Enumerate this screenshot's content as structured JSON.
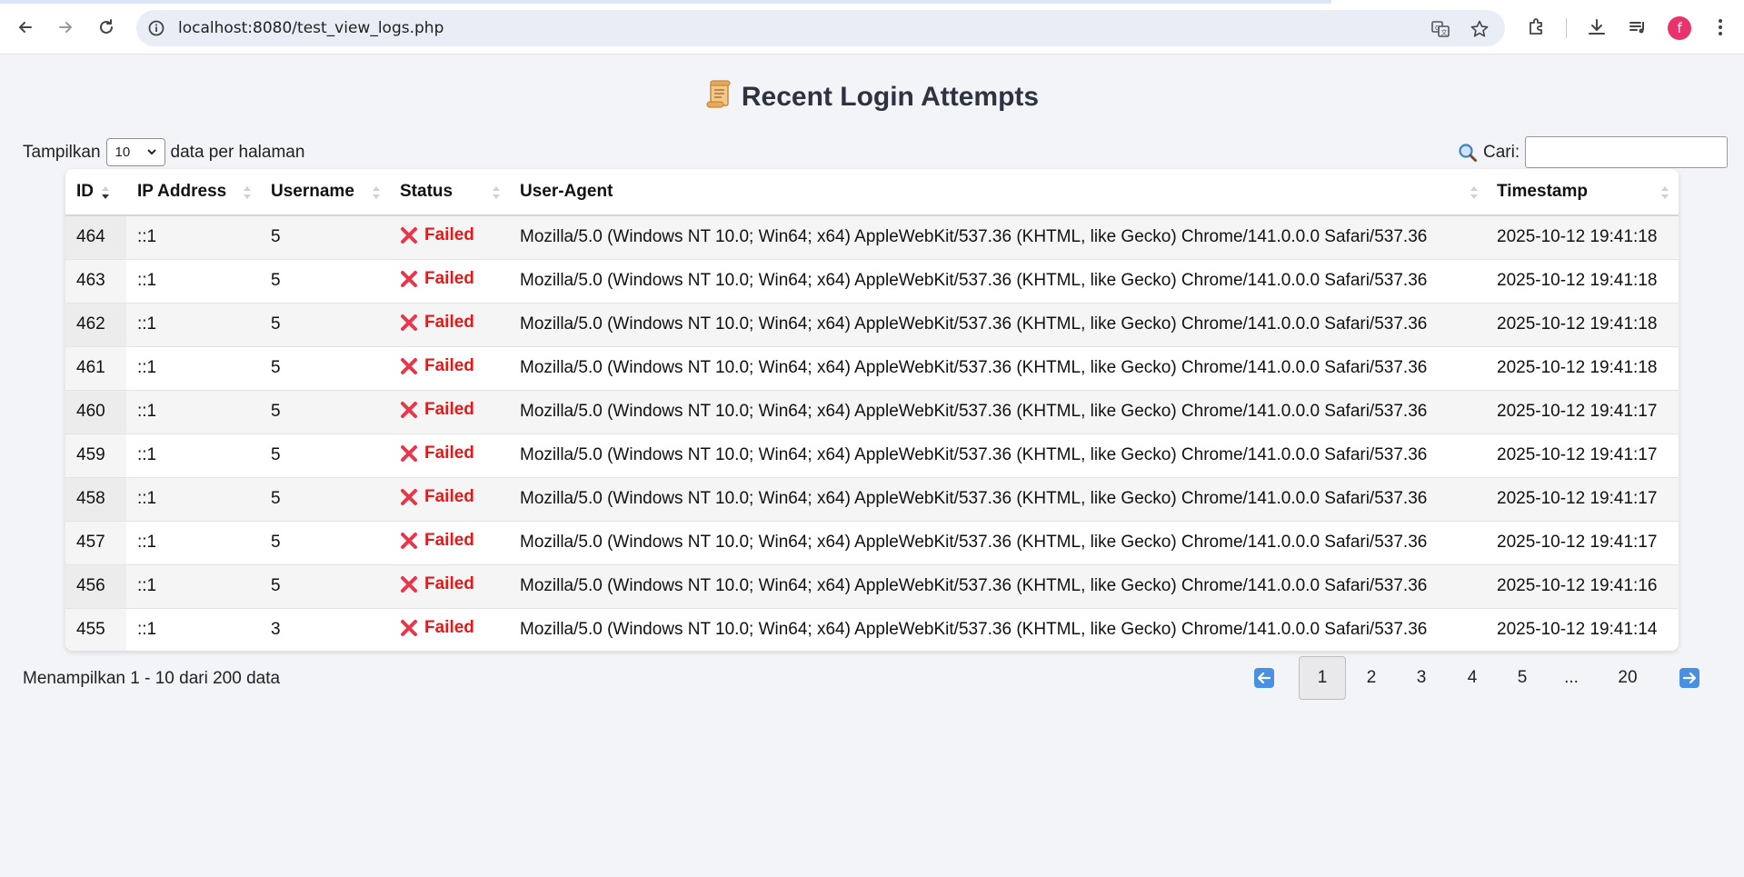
{
  "browser": {
    "url": "localhost:8080/test_view_logs.php",
    "avatar_letter": "f",
    "avatar_color": "#e8336d"
  },
  "page": {
    "title": "Recent Login Attempts",
    "title_icon": "scroll-icon",
    "show_label_prefix": "Tampilkan",
    "page_length": "10",
    "show_label_suffix": "data per halaman",
    "search_label": "Cari:",
    "search_value": "",
    "info": "Menampilkan 1 - 10 dari 200 data"
  },
  "table": {
    "columns": [
      "ID",
      "IP Address",
      "Username",
      "Status",
      "User-Agent",
      "Timestamp"
    ],
    "rows": [
      {
        "id": "464",
        "ip": "::1",
        "username": "5",
        "status": "Failed",
        "ua": "Mozilla/5.0 (Windows NT 10.0; Win64; x64) AppleWebKit/537.36 (KHTML, like Gecko) Chrome/141.0.0.0 Safari/537.36",
        "ts": "2025-10-12 19:41:18"
      },
      {
        "id": "463",
        "ip": "::1",
        "username": "5",
        "status": "Failed",
        "ua": "Mozilla/5.0 (Windows NT 10.0; Win64; x64) AppleWebKit/537.36 (KHTML, like Gecko) Chrome/141.0.0.0 Safari/537.36",
        "ts": "2025-10-12 19:41:18"
      },
      {
        "id": "462",
        "ip": "::1",
        "username": "5",
        "status": "Failed",
        "ua": "Mozilla/5.0 (Windows NT 10.0; Win64; x64) AppleWebKit/537.36 (KHTML, like Gecko) Chrome/141.0.0.0 Safari/537.36",
        "ts": "2025-10-12 19:41:18"
      },
      {
        "id": "461",
        "ip": "::1",
        "username": "5",
        "status": "Failed",
        "ua": "Mozilla/5.0 (Windows NT 10.0; Win64; x64) AppleWebKit/537.36 (KHTML, like Gecko) Chrome/141.0.0.0 Safari/537.36",
        "ts": "2025-10-12 19:41:18"
      },
      {
        "id": "460",
        "ip": "::1",
        "username": "5",
        "status": "Failed",
        "ua": "Mozilla/5.0 (Windows NT 10.0; Win64; x64) AppleWebKit/537.36 (KHTML, like Gecko) Chrome/141.0.0.0 Safari/537.36",
        "ts": "2025-10-12 19:41:17"
      },
      {
        "id": "459",
        "ip": "::1",
        "username": "5",
        "status": "Failed",
        "ua": "Mozilla/5.0 (Windows NT 10.0; Win64; x64) AppleWebKit/537.36 (KHTML, like Gecko) Chrome/141.0.0.0 Safari/537.36",
        "ts": "2025-10-12 19:41:17"
      },
      {
        "id": "458",
        "ip": "::1",
        "username": "5",
        "status": "Failed",
        "ua": "Mozilla/5.0 (Windows NT 10.0; Win64; x64) AppleWebKit/537.36 (KHTML, like Gecko) Chrome/141.0.0.0 Safari/537.36",
        "ts": "2025-10-12 19:41:17"
      },
      {
        "id": "457",
        "ip": "::1",
        "username": "5",
        "status": "Failed",
        "ua": "Mozilla/5.0 (Windows NT 10.0; Win64; x64) AppleWebKit/537.36 (KHTML, like Gecko) Chrome/141.0.0.0 Safari/537.36",
        "ts": "2025-10-12 19:41:17"
      },
      {
        "id": "456",
        "ip": "::1",
        "username": "5",
        "status": "Failed",
        "ua": "Mozilla/5.0 (Windows NT 10.0; Win64; x64) AppleWebKit/537.36 (KHTML, like Gecko) Chrome/141.0.0.0 Safari/537.36",
        "ts": "2025-10-12 19:41:16"
      },
      {
        "id": "455",
        "ip": "::1",
        "username": "3",
        "status": "Failed",
        "ua": "Mozilla/5.0 (Windows NT 10.0; Win64; x64) AppleWebKit/537.36 (KHTML, like Gecko) Chrome/141.0.0.0 Safari/537.36",
        "ts": "2025-10-12 19:41:14"
      }
    ]
  },
  "pagination": {
    "pages": [
      "1",
      "2",
      "3",
      "4",
      "5",
      "...",
      "20"
    ],
    "active": "1",
    "prev_icon": "left-arrow-icon",
    "next_icon": "right-arrow-icon"
  },
  "colors": {
    "failed": "#e01b1b",
    "accent": "#4a90e2"
  }
}
